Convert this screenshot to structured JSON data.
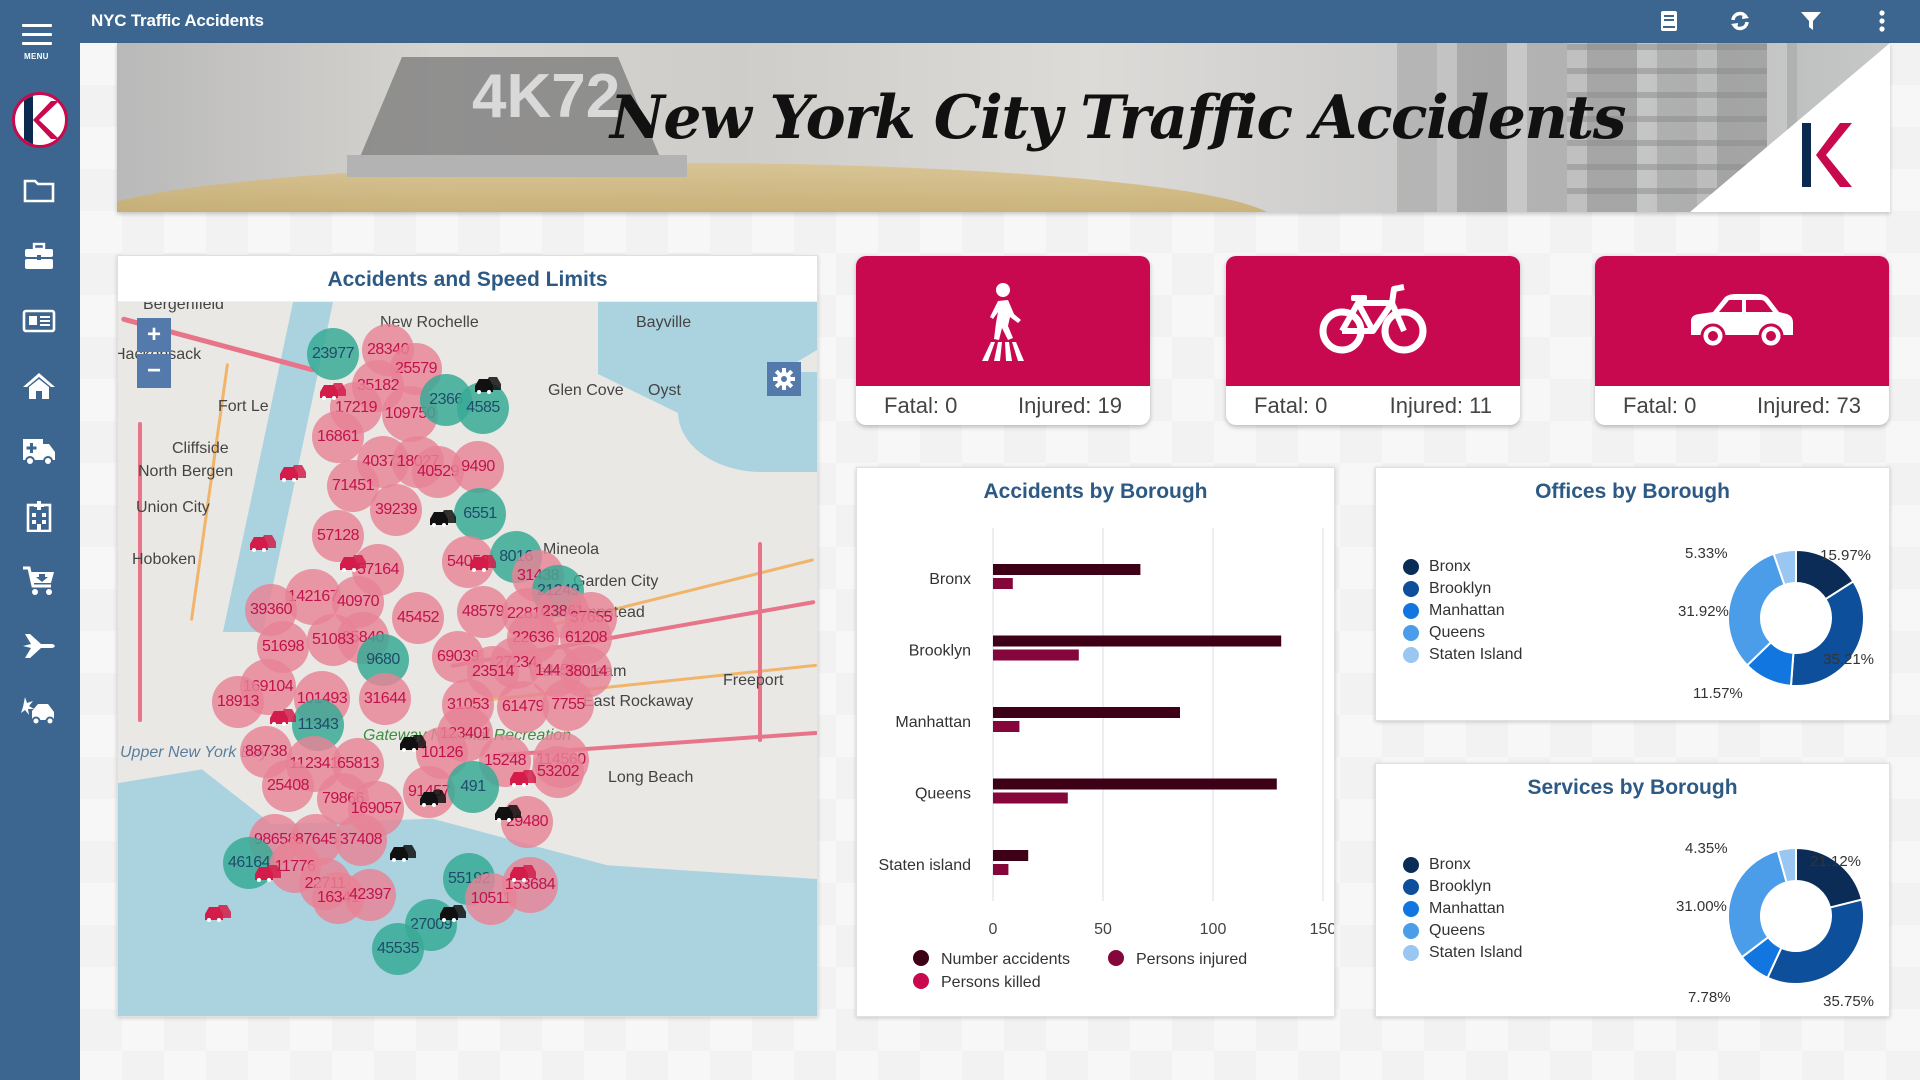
{
  "app": {
    "title": "NYC Traffic Accidents",
    "menu_label": "MENU"
  },
  "toolbar": {
    "icons": [
      "book-icon",
      "refresh-icon",
      "filter-icon",
      "more-vertical-icon"
    ]
  },
  "sidebar": {
    "items": [
      {
        "icon": "folder-icon"
      },
      {
        "icon": "briefcase-icon"
      },
      {
        "icon": "newspaper-icon"
      },
      {
        "icon": "home-icon"
      },
      {
        "icon": "ambulance-icon"
      },
      {
        "icon": "hospital-icon"
      },
      {
        "icon": "cart-icon"
      },
      {
        "icon": "plane-icon"
      },
      {
        "icon": "car-crash-icon"
      }
    ]
  },
  "banner": {
    "headline": "New York City Traffic Accidents",
    "taxi_number": "4K72"
  },
  "map": {
    "title": "Accidents and Speed Limits",
    "zoom_in": "+",
    "zoom_out": "−",
    "places": [
      {
        "name": "Bergenfield"
      },
      {
        "name": "New Rochelle"
      },
      {
        "name": "Bayville"
      },
      {
        "name": "Hackensack"
      },
      {
        "name": "Glen Cove"
      },
      {
        "name": "Oyst"
      },
      {
        "name": "Fort Le"
      },
      {
        "name": "Cliffside"
      },
      {
        "name": "North Bergen"
      },
      {
        "name": "Union City"
      },
      {
        "name": "Hoboken"
      },
      {
        "name": "Mineola"
      },
      {
        "name": "Garden City"
      },
      {
        "name": "Hempstead"
      },
      {
        "name": "Valley Stream"
      },
      {
        "name": "Freeport"
      },
      {
        "name": "East Rockaway"
      },
      {
        "name": "Long Beach"
      },
      {
        "name": "Upper New York Bay"
      },
      {
        "name": "Gateway National Recreation"
      }
    ],
    "clusters": [
      {
        "label": "23977",
        "type": "teal"
      },
      {
        "label": "28340",
        "type": "pink"
      },
      {
        "label": "25579",
        "type": "pink"
      },
      {
        "label": "35182",
        "type": "pink"
      },
      {
        "label": "17219",
        "type": "pink"
      },
      {
        "label": "109750",
        "type": "pink"
      },
      {
        "label": "2366",
        "type": "teal"
      },
      {
        "label": "4585",
        "type": "teal"
      },
      {
        "label": "16861",
        "type": "pink"
      },
      {
        "label": "40372",
        "type": "pink"
      },
      {
        "label": "18027",
        "type": "pink"
      },
      {
        "label": "40529",
        "type": "pink"
      },
      {
        "label": "9490",
        "type": "pink"
      },
      {
        "label": "71451",
        "type": "pink"
      },
      {
        "label": "6551",
        "type": "teal"
      },
      {
        "label": "39239",
        "type": "pink"
      },
      {
        "label": "57128",
        "type": "pink"
      },
      {
        "label": "54058",
        "type": "pink"
      },
      {
        "label": "8016",
        "type": "teal"
      },
      {
        "label": "57164",
        "type": "pink"
      },
      {
        "label": "31438",
        "type": "pink"
      },
      {
        "label": "21249",
        "type": "teal"
      },
      {
        "label": "142167",
        "type": "pink"
      },
      {
        "label": "39360",
        "type": "pink"
      },
      {
        "label": "40970",
        "type": "pink"
      },
      {
        "label": "45452",
        "type": "pink"
      },
      {
        "label": "48579",
        "type": "pink"
      },
      {
        "label": "22810",
        "type": "pink"
      },
      {
        "label": "23861",
        "type": "pink"
      },
      {
        "label": "37655",
        "type": "pink"
      },
      {
        "label": "22636",
        "type": "pink"
      },
      {
        "label": "61208",
        "type": "pink"
      },
      {
        "label": "25840",
        "type": "pink"
      },
      {
        "label": "51698",
        "type": "pink"
      },
      {
        "label": "51083",
        "type": "pink"
      },
      {
        "label": "9680",
        "type": "teal"
      },
      {
        "label": "69039",
        "type": "pink"
      },
      {
        "label": "27234",
        "type": "pink"
      },
      {
        "label": "14450",
        "type": "pink"
      },
      {
        "label": "38014",
        "type": "pink"
      },
      {
        "label": "169104",
        "type": "pink"
      },
      {
        "label": "23514",
        "type": "pink"
      },
      {
        "label": "18913",
        "type": "pink"
      },
      {
        "label": "101493",
        "type": "pink"
      },
      {
        "label": "31644",
        "type": "pink"
      },
      {
        "label": "31053",
        "type": "pink"
      },
      {
        "label": "61479",
        "type": "pink"
      },
      {
        "label": "7755",
        "type": "pink"
      },
      {
        "label": "11343",
        "type": "teal"
      },
      {
        "label": "123401",
        "type": "pink"
      },
      {
        "label": "88738",
        "type": "pink"
      },
      {
        "label": "112341",
        "type": "pink"
      },
      {
        "label": "65813",
        "type": "pink"
      },
      {
        "label": "10126",
        "type": "pink"
      },
      {
        "label": "15248",
        "type": "pink"
      },
      {
        "label": "114560",
        "type": "pink"
      },
      {
        "label": "53202",
        "type": "pink"
      },
      {
        "label": "25408",
        "type": "pink"
      },
      {
        "label": "79866",
        "type": "pink"
      },
      {
        "label": "169057",
        "type": "pink"
      },
      {
        "label": "91457",
        "type": "pink"
      },
      {
        "label": "491",
        "type": "teal"
      },
      {
        "label": "29480",
        "type": "pink"
      },
      {
        "label": "98658",
        "type": "pink"
      },
      {
        "label": "87645",
        "type": "pink"
      },
      {
        "label": "37408",
        "type": "pink"
      },
      {
        "label": "46164",
        "type": "teal"
      },
      {
        "label": "11776",
        "type": "pink"
      },
      {
        "label": "22711",
        "type": "pink"
      },
      {
        "label": "16341",
        "type": "pink"
      },
      {
        "label": "42397",
        "type": "pink"
      },
      {
        "label": "55192",
        "type": "teal"
      },
      {
        "label": "10511",
        "type": "pink"
      },
      {
        "label": "153684",
        "type": "pink"
      },
      {
        "label": "27009",
        "type": "teal"
      },
      {
        "label": "45535",
        "type": "teal"
      }
    ]
  },
  "cards": [
    {
      "icon": "pedestrian-icon",
      "fatal_label": "Fatal: 0",
      "injured_label": "Injured: 19",
      "fatal": 0,
      "injured": 19
    },
    {
      "icon": "bicycle-icon",
      "fatal_label": "Fatal: 0",
      "injured_label": "Injured: 11",
      "fatal": 0,
      "injured": 11
    },
    {
      "icon": "car-icon",
      "fatal_label": "Fatal: 0",
      "injured_label": "Injured: 73",
      "fatal": 0,
      "injured": 73
    }
  ],
  "colors": {
    "brand_blue": "#3c6690",
    "accent_crimson": "#c8094f",
    "title_blue": "#2d5a85"
  },
  "chart_data": [
    {
      "type": "bar",
      "orientation": "horizontal",
      "title": "Accidents by Borough",
      "categories": [
        "Bronx",
        "Brooklyn",
        "Manhattan",
        "Queens",
        "Staten island"
      ],
      "series": [
        {
          "name": "Number accidents",
          "color": "#3d0016",
          "values": [
            67,
            131,
            85,
            129,
            16
          ]
        },
        {
          "name": "Persons injured",
          "color": "#85063a",
          "values": [
            9,
            39,
            12,
            34,
            7
          ]
        },
        {
          "name": "Persons killed",
          "color": "#c8094f",
          "values": [
            0,
            0,
            0,
            0,
            0
          ]
        }
      ],
      "xticks": [
        "0",
        "50",
        "100",
        "150"
      ],
      "xlim": [
        0,
        150
      ],
      "grid": true,
      "legend": "bottom",
      "xlabel": "",
      "ylabel": ""
    },
    {
      "type": "pie",
      "donut": true,
      "title": "Offices by Borough",
      "categories": [
        "Bronx",
        "Brooklyn",
        "Manhattan",
        "Queens",
        "Staten Island"
      ],
      "values": [
        15.97,
        35.21,
        11.57,
        31.92,
        5.33
      ],
      "labels": [
        "15.97%",
        "35.21%",
        "11.57%",
        "31.92%",
        "5.33%"
      ],
      "colors": [
        "#0b2c57",
        "#0d4f9a",
        "#1176e0",
        "#4b9ce9",
        "#9ac6f2"
      ],
      "legend": "left"
    },
    {
      "type": "pie",
      "donut": true,
      "title": "Services by Borough",
      "categories": [
        "Bronx",
        "Brooklyn",
        "Manhattan",
        "Queens",
        "Staten Island"
      ],
      "values": [
        21.12,
        35.75,
        7.78,
        31.0,
        4.35
      ],
      "labels": [
        "21.12%",
        "35.75%",
        "7.78%",
        "31.00%",
        "4.35%"
      ],
      "colors": [
        "#0b2c57",
        "#0d4f9a",
        "#1176e0",
        "#4b9ce9",
        "#9ac6f2"
      ],
      "legend": "left"
    }
  ]
}
